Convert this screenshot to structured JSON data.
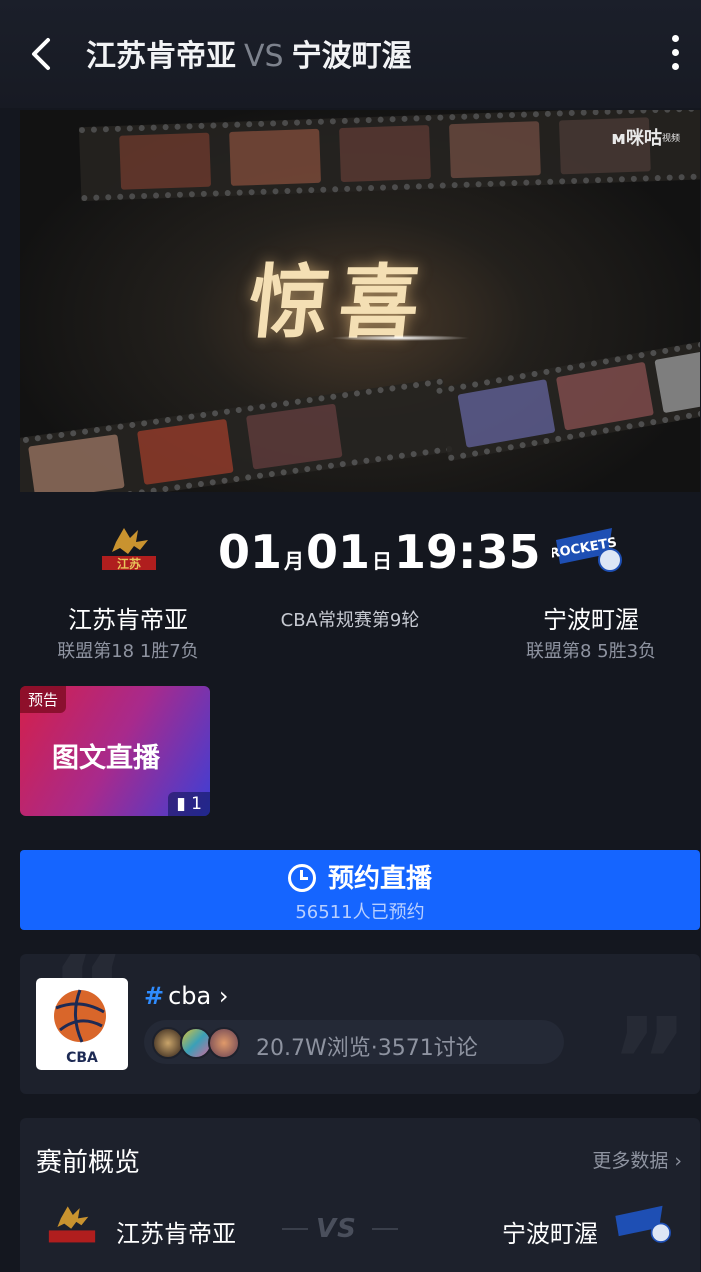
{
  "header": {
    "home_team": "江苏肯帝亚",
    "vs": "VS",
    "away_team": "宁波町渥",
    "back_icon": "back-arrow-icon",
    "more_icon": "more-vertical-icon"
  },
  "video": {
    "headline": "惊喜",
    "watermark": "咪咕",
    "watermark_sub": "视频"
  },
  "match": {
    "month": "01",
    "month_unit": "月",
    "day": "01",
    "day_unit": "日",
    "time": "19:35",
    "round": "CBA常规赛第9轮",
    "home": {
      "name": "江苏肯帝亚",
      "record": "联盟第18 1胜7负"
    },
    "away": {
      "name": "宁波町渥",
      "record": "联盟第8 5胜3负"
    }
  },
  "live_card": {
    "tag": "预告",
    "label": "图文直播",
    "count": "1"
  },
  "reserve": {
    "label": "预约直播",
    "count_text": "56511人已预约",
    "icon": "clock-icon"
  },
  "topic": {
    "hash": "#",
    "name": "cba",
    "chevron": "›",
    "stats": "20.7W浏览·3571讨论",
    "logo_text": "CBA"
  },
  "preview": {
    "title": "赛前概览",
    "more": "更多数据",
    "chevron": "›",
    "home_name": "江苏肯帝亚",
    "vs": "VS",
    "away_name": "宁波町渥"
  },
  "colors": {
    "background": "#14171f",
    "card": "#1d212c",
    "primary_button": "#1565ff",
    "hashtag": "#2f8cff"
  }
}
